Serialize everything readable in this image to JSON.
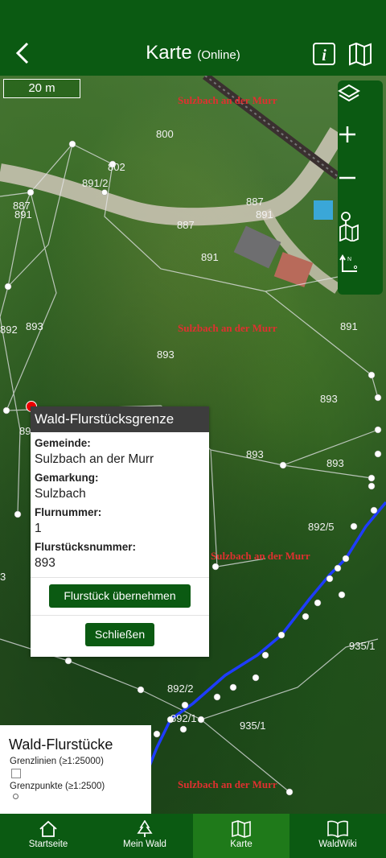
{
  "header": {
    "title": "Karte",
    "subtitle": "(Online)"
  },
  "map": {
    "scale_label": "20 m",
    "parcel_labels": [
      "800",
      "802",
      "891/2",
      "887",
      "891",
      "887",
      "891",
      "887",
      "891",
      "893",
      "893",
      "891",
      "893",
      "893",
      "893",
      "892/5",
      "935/1",
      "892/2",
      "892/1",
      "935/1",
      "892",
      "89",
      "3"
    ],
    "place_labels": [
      "Sulzbach an der Murr",
      "Sulzbach an der Murr",
      "Sulzbach an der Murr",
      "Sulzbach an der Murr"
    ]
  },
  "popup": {
    "title": "Wald-Flurstücksgrenze",
    "gemeinde_label": "Gemeinde:",
    "gemeinde_value": "Sulzbach an der Murr",
    "gemarkung_label": "Gemarkung:",
    "gemarkung_value": "Sulzbach",
    "flurnummer_label": "Flurnummer:",
    "flurnummer_value": "1",
    "flurstuecksnummer_label": "Flurstücksnummer:",
    "flurstuecksnummer_value": "893",
    "apply_button": "Flurstück übernehmen",
    "close_button": "Schließen"
  },
  "legend": {
    "title": "Wald-Flurstücke",
    "lines_label": "Grenzlinien (≥1:25000)",
    "points_label": "Grenzpunkte (≥1:2500)"
  },
  "nav": {
    "items": [
      {
        "label": "Startseite",
        "icon": "home-icon"
      },
      {
        "label": "Mein Wald",
        "icon": "tree-icon"
      },
      {
        "label": "Karte",
        "icon": "map-icon"
      },
      {
        "label": "WaldWiki",
        "icon": "book-icon"
      }
    ],
    "active": "Karte"
  },
  "colors": {
    "brand": "#0b5a12",
    "active_tab": "#1f7a1a",
    "popup_header": "#3d3d3d",
    "route": "#1e3cff",
    "place_label": "#e03030"
  }
}
